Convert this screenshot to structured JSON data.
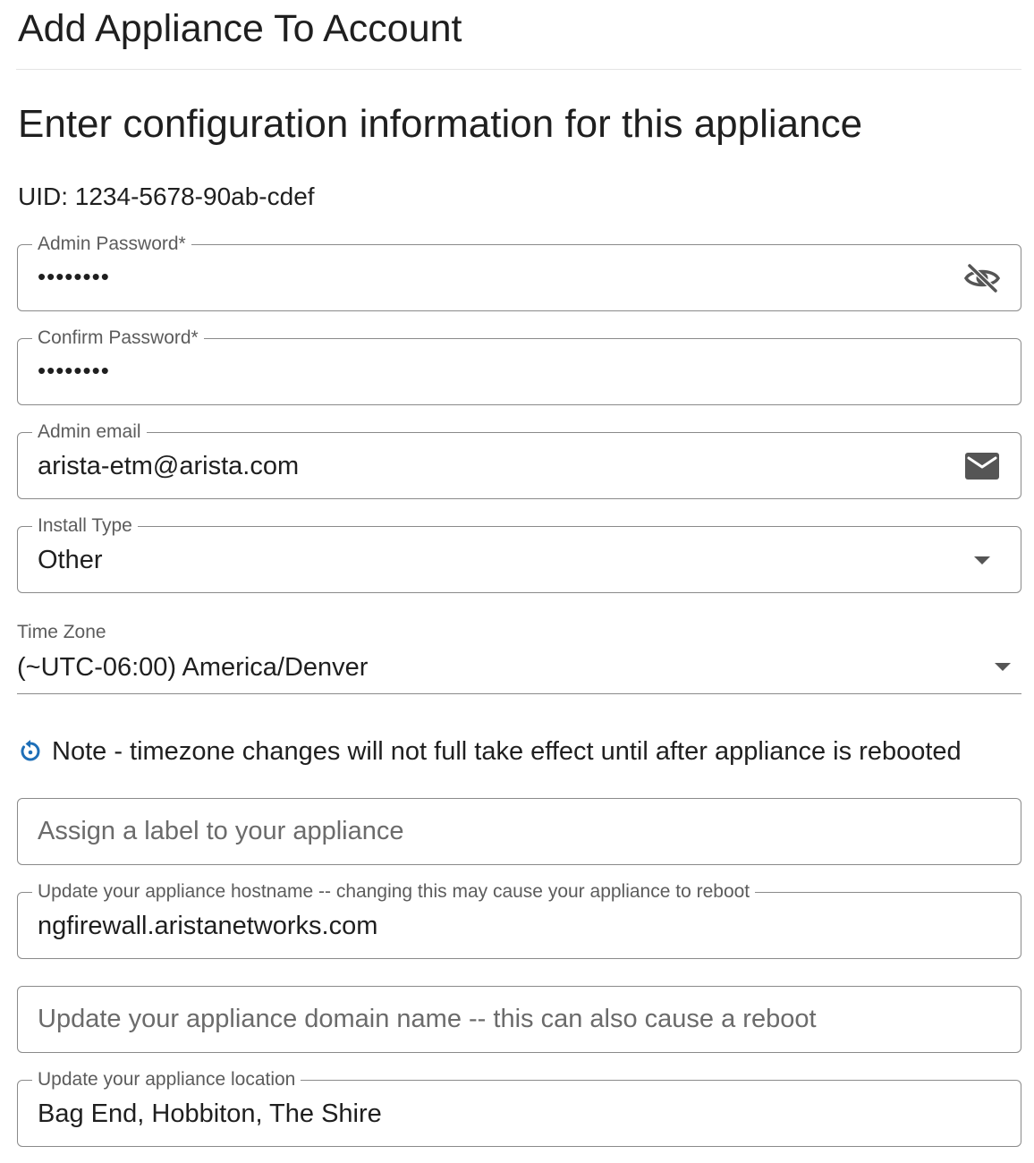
{
  "header": {
    "title": "Add Appliance To Account"
  },
  "section": {
    "heading": "Enter configuration information for this appliance"
  },
  "uid": {
    "label": "UID: 1234-5678-90ab-cdef"
  },
  "admin_password": {
    "label": "Admin Password*",
    "value": "••••••••",
    "icon": "visibility-off-icon"
  },
  "confirm_password": {
    "label": "Confirm Password*",
    "value": "••••••••"
  },
  "admin_email": {
    "label": "Admin email",
    "value": "arista-etm@arista.com",
    "icon": "mail-icon"
  },
  "install_type": {
    "label": "Install Type",
    "value": "Other",
    "icon": "caret-down-icon"
  },
  "time_zone": {
    "label": "Time Zone",
    "value": "(~UTC-06:00) America/Denver",
    "icon": "caret-down-icon"
  },
  "note": {
    "text": "Note - timezone changes will not full take effect until after appliance is rebooted",
    "icon": "restart-icon",
    "icon_color": "#1e6fb8"
  },
  "appliance_label": {
    "placeholder": "Assign a label to your appliance",
    "value": ""
  },
  "hostname": {
    "label": "Update your appliance hostname -- changing this may cause your appliance to reboot",
    "value": "ngfirewall.aristanetworks.com"
  },
  "domain_name": {
    "placeholder": "Update your appliance domain name -- this can also cause a reboot",
    "value": ""
  },
  "location": {
    "label": "Update your appliance location",
    "value": "Bag End, Hobbiton, The Shire"
  }
}
